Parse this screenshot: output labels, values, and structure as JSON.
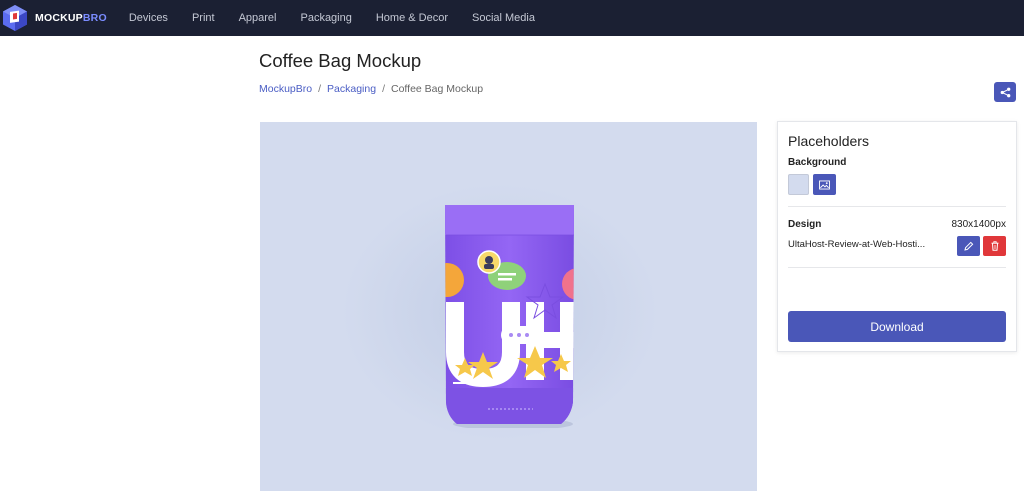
{
  "header": {
    "brand_main": "MOCKUP",
    "brand_accent": "BRO",
    "nav": [
      "Devices",
      "Print",
      "Apparel",
      "Packaging",
      "Home & Decor",
      "Social Media"
    ]
  },
  "page": {
    "title": "Coffee Bag Mockup",
    "breadcrumb": [
      "MockupBro",
      "Packaging",
      "Coffee Bag Mockup"
    ]
  },
  "preview": {
    "background_color": "#d3dbee",
    "bag_color": "#8f62f0"
  },
  "panel": {
    "title": "Placeholders",
    "background_label": "Background",
    "design_label": "Design",
    "design_size": "830x1400px",
    "design_file": "UltaHost-Review-at-Web-Hosti...",
    "download_label": "Download"
  },
  "colors": {
    "topbar": "#1b2033",
    "primary": "#4a57b8",
    "danger": "#e0373a"
  },
  "icons": [
    "share-icon",
    "image-icon",
    "pencil-icon",
    "trash-icon"
  ]
}
